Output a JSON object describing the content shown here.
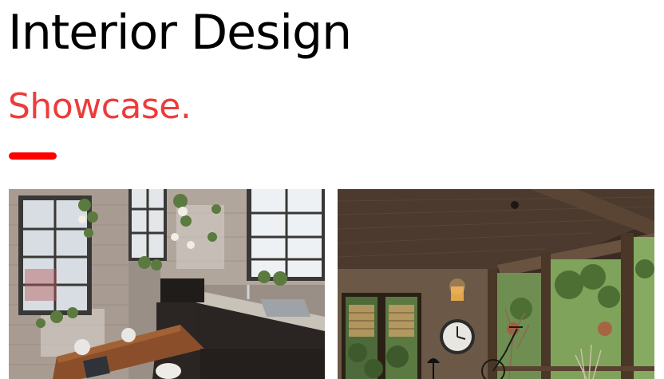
{
  "header": {
    "title": "Interior Design",
    "subtitle": "Showcase."
  },
  "colors": {
    "accent": "#ff0000",
    "subtitle": "#ee3b3b"
  },
  "gallery": {
    "photos": [
      {
        "name": "loft-kitchen-photo"
      },
      {
        "name": "covered-porch-photo"
      }
    ]
  }
}
